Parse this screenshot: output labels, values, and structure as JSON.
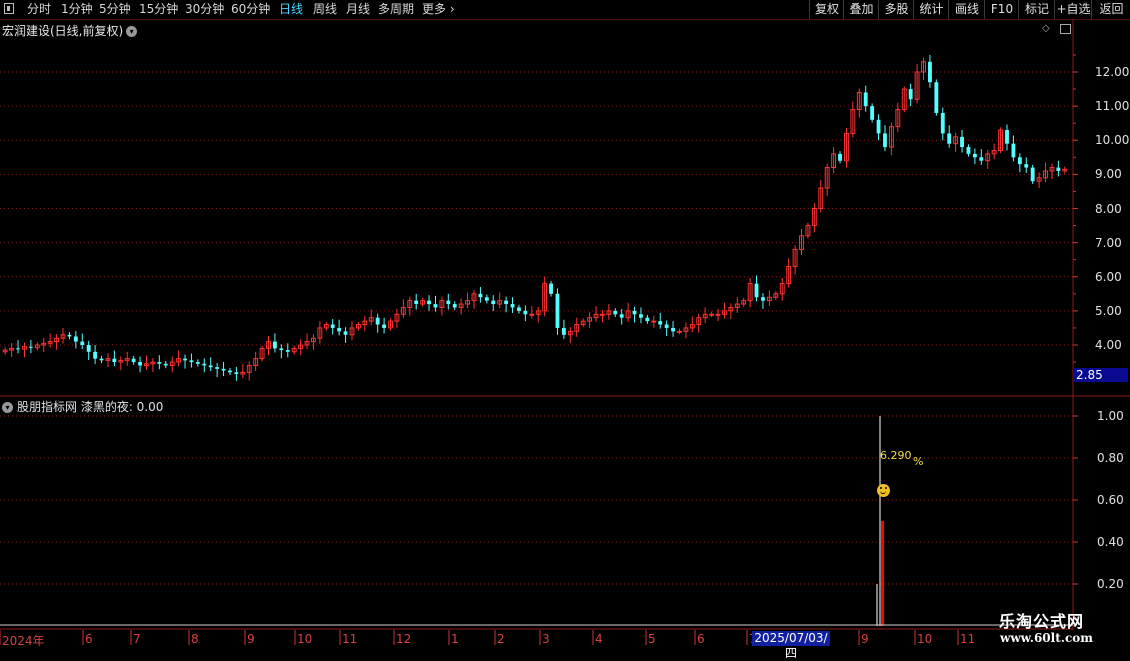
{
  "toolbar": {
    "periods": [
      "分时",
      "1分钟",
      "5分钟",
      "15分钟",
      "30分钟",
      "60分钟",
      "日线",
      "周线",
      "月线",
      "多周期",
      "更多"
    ],
    "active_period": "日线",
    "buttons": [
      "复权",
      "叠加",
      "多股",
      "统计",
      "画线",
      "F10",
      "标记",
      "+自选",
      "返回"
    ]
  },
  "main": {
    "title": "宏润建设(日线,前复权)",
    "current_price_label": "2.85",
    "y_labels": [
      "12.00",
      "11.00",
      "10.00",
      "9.00",
      "8.00",
      "7.00",
      "6.00",
      "5.00",
      "4.00"
    ]
  },
  "indicator": {
    "title": "股朋指标网 漆黑的夜: 0.00",
    "y_labels": [
      "1.00",
      "0.80",
      "0.60",
      "0.40",
      "0.20"
    ],
    "annotation": "6.290",
    "annotation_unit": "%"
  },
  "x_axis": {
    "labels": [
      "2024年",
      "6",
      "7",
      "8",
      "9",
      "10",
      "11",
      "12",
      "1",
      "2",
      "3",
      "4",
      "5",
      "6",
      "7",
      "9",
      "10",
      "11"
    ],
    "cursor_date": "2025/07/03/四"
  },
  "watermark": {
    "name": "乐淘公式网",
    "url": "www.60lt.com"
  },
  "colors": {
    "up": "#ff3232",
    "down": "#54ffff",
    "grid": "#8b1a1a",
    "active": "#46d8ff",
    "highlight": "#1020a0"
  },
  "chart_data": {
    "type": "candlestick",
    "y_range": [
      3.0,
      12.9
    ],
    "closes": [
      3.85,
      3.9,
      3.88,
      3.95,
      3.92,
      4.0,
      4.05,
      4.1,
      4.2,
      4.3,
      4.25,
      4.1,
      4.0,
      3.8,
      3.6,
      3.55,
      3.6,
      3.5,
      3.55,
      3.6,
      3.5,
      3.4,
      3.45,
      3.5,
      3.45,
      3.4,
      3.5,
      3.6,
      3.55,
      3.5,
      3.45,
      3.4,
      3.35,
      3.3,
      3.25,
      3.2,
      3.15,
      3.2,
      3.4,
      3.6,
      3.9,
      4.1,
      3.9,
      3.85,
      3.8,
      3.9,
      4.0,
      4.1,
      4.2,
      4.5,
      4.6,
      4.5,
      4.4,
      4.3,
      4.5,
      4.6,
      4.7,
      4.8,
      4.6,
      4.5,
      4.7,
      4.9,
      5.1,
      5.3,
      5.2,
      5.3,
      5.2,
      5.1,
      5.3,
      5.2,
      5.1,
      5.2,
      5.3,
      5.5,
      5.4,
      5.3,
      5.2,
      5.3,
      5.2,
      5.1,
      5.0,
      4.9,
      4.9,
      5.0,
      5.8,
      5.5,
      4.5,
      4.3,
      4.4,
      4.6,
      4.7,
      4.8,
      4.9,
      4.9,
      5.0,
      4.9,
      4.8,
      5.0,
      4.9,
      4.8,
      4.7,
      4.7,
      4.6,
      4.5,
      4.4,
      4.4,
      4.5,
      4.6,
      4.8,
      4.9,
      4.9,
      4.9,
      5.0,
      5.1,
      5.2,
      5.3,
      5.8,
      5.4,
      5.3,
      5.4,
      5.5,
      5.8,
      6.3,
      6.8,
      7.2,
      7.5,
      8.0,
      8.6,
      9.2,
      9.6,
      9.4,
      10.2,
      10.9,
      11.4,
      11.0,
      10.6,
      10.2,
      9.8,
      10.4,
      10.9,
      11.5,
      11.2,
      12.0,
      12.3,
      11.7,
      10.8,
      10.2,
      9.9,
      10.1,
      9.8,
      9.6,
      9.5,
      9.4,
      9.6,
      9.7,
      10.3,
      9.9,
      9.5,
      9.3,
      9.2,
      8.8,
      8.9,
      9.1,
      9.2,
      9.1,
      9.15
    ]
  }
}
